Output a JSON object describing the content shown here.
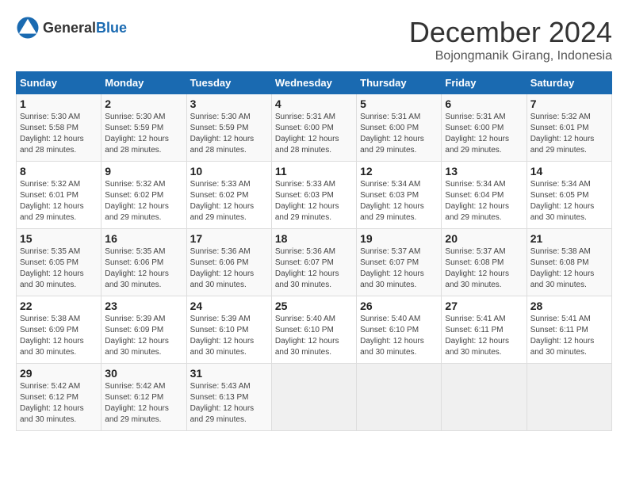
{
  "header": {
    "logo_general": "General",
    "logo_blue": "Blue",
    "month_title": "December 2024",
    "location": "Bojongmanik Girang, Indonesia"
  },
  "days_of_week": [
    "Sunday",
    "Monday",
    "Tuesday",
    "Wednesday",
    "Thursday",
    "Friday",
    "Saturday"
  ],
  "weeks": [
    [
      {
        "day": "1",
        "sunrise": "5:30 AM",
        "sunset": "5:58 PM",
        "daylight": "12 hours and 28 minutes."
      },
      {
        "day": "2",
        "sunrise": "5:30 AM",
        "sunset": "5:59 PM",
        "daylight": "12 hours and 28 minutes."
      },
      {
        "day": "3",
        "sunrise": "5:30 AM",
        "sunset": "5:59 PM",
        "daylight": "12 hours and 28 minutes."
      },
      {
        "day": "4",
        "sunrise": "5:31 AM",
        "sunset": "6:00 PM",
        "daylight": "12 hours and 28 minutes."
      },
      {
        "day": "5",
        "sunrise": "5:31 AM",
        "sunset": "6:00 PM",
        "daylight": "12 hours and 29 minutes."
      },
      {
        "day": "6",
        "sunrise": "5:31 AM",
        "sunset": "6:00 PM",
        "daylight": "12 hours and 29 minutes."
      },
      {
        "day": "7",
        "sunrise": "5:32 AM",
        "sunset": "6:01 PM",
        "daylight": "12 hours and 29 minutes."
      }
    ],
    [
      {
        "day": "8",
        "sunrise": "5:32 AM",
        "sunset": "6:01 PM",
        "daylight": "12 hours and 29 minutes."
      },
      {
        "day": "9",
        "sunrise": "5:32 AM",
        "sunset": "6:02 PM",
        "daylight": "12 hours and 29 minutes."
      },
      {
        "day": "10",
        "sunrise": "5:33 AM",
        "sunset": "6:02 PM",
        "daylight": "12 hours and 29 minutes."
      },
      {
        "day": "11",
        "sunrise": "5:33 AM",
        "sunset": "6:03 PM",
        "daylight": "12 hours and 29 minutes."
      },
      {
        "day": "12",
        "sunrise": "5:34 AM",
        "sunset": "6:03 PM",
        "daylight": "12 hours and 29 minutes."
      },
      {
        "day": "13",
        "sunrise": "5:34 AM",
        "sunset": "6:04 PM",
        "daylight": "12 hours and 29 minutes."
      },
      {
        "day": "14",
        "sunrise": "5:34 AM",
        "sunset": "6:05 PM",
        "daylight": "12 hours and 30 minutes."
      }
    ],
    [
      {
        "day": "15",
        "sunrise": "5:35 AM",
        "sunset": "6:05 PM",
        "daylight": "12 hours and 30 minutes."
      },
      {
        "day": "16",
        "sunrise": "5:35 AM",
        "sunset": "6:06 PM",
        "daylight": "12 hours and 30 minutes."
      },
      {
        "day": "17",
        "sunrise": "5:36 AM",
        "sunset": "6:06 PM",
        "daylight": "12 hours and 30 minutes."
      },
      {
        "day": "18",
        "sunrise": "5:36 AM",
        "sunset": "6:07 PM",
        "daylight": "12 hours and 30 minutes."
      },
      {
        "day": "19",
        "sunrise": "5:37 AM",
        "sunset": "6:07 PM",
        "daylight": "12 hours and 30 minutes."
      },
      {
        "day": "20",
        "sunrise": "5:37 AM",
        "sunset": "6:08 PM",
        "daylight": "12 hours and 30 minutes."
      },
      {
        "day": "21",
        "sunrise": "5:38 AM",
        "sunset": "6:08 PM",
        "daylight": "12 hours and 30 minutes."
      }
    ],
    [
      {
        "day": "22",
        "sunrise": "5:38 AM",
        "sunset": "6:09 PM",
        "daylight": "12 hours and 30 minutes."
      },
      {
        "day": "23",
        "sunrise": "5:39 AM",
        "sunset": "6:09 PM",
        "daylight": "12 hours and 30 minutes."
      },
      {
        "day": "24",
        "sunrise": "5:39 AM",
        "sunset": "6:10 PM",
        "daylight": "12 hours and 30 minutes."
      },
      {
        "day": "25",
        "sunrise": "5:40 AM",
        "sunset": "6:10 PM",
        "daylight": "12 hours and 30 minutes."
      },
      {
        "day": "26",
        "sunrise": "5:40 AM",
        "sunset": "6:10 PM",
        "daylight": "12 hours and 30 minutes."
      },
      {
        "day": "27",
        "sunrise": "5:41 AM",
        "sunset": "6:11 PM",
        "daylight": "12 hours and 30 minutes."
      },
      {
        "day": "28",
        "sunrise": "5:41 AM",
        "sunset": "6:11 PM",
        "daylight": "12 hours and 30 minutes."
      }
    ],
    [
      {
        "day": "29",
        "sunrise": "5:42 AM",
        "sunset": "6:12 PM",
        "daylight": "12 hours and 30 minutes."
      },
      {
        "day": "30",
        "sunrise": "5:42 AM",
        "sunset": "6:12 PM",
        "daylight": "12 hours and 29 minutes."
      },
      {
        "day": "31",
        "sunrise": "5:43 AM",
        "sunset": "6:13 PM",
        "daylight": "12 hours and 29 minutes."
      },
      null,
      null,
      null,
      null
    ]
  ]
}
